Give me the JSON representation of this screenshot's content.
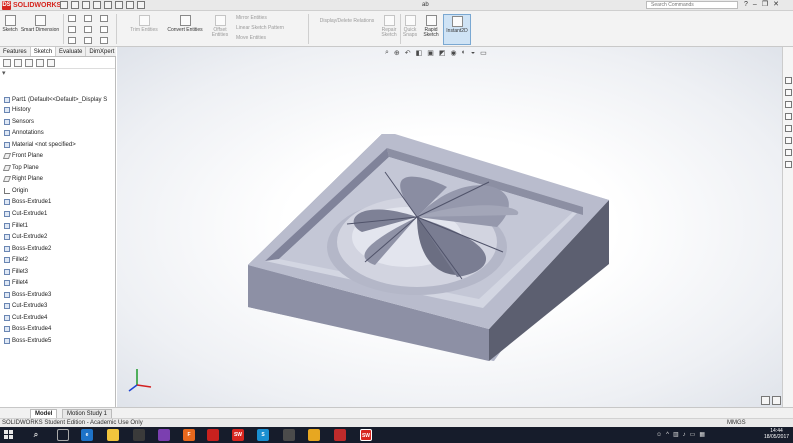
{
  "app": {
    "logo_text": "SOLIDWORKS",
    "logo_mark": "DS",
    "doc_title": "ab",
    "search_placeholder": "Search Commands"
  },
  "ribbon": {
    "sketch": "Sketch",
    "smart_dimension": "Smart Dimension",
    "trim": "Trim Entities",
    "convert": "Convert Entities",
    "offset": "Offset Entities",
    "mirror": "Mirror Entities",
    "linear_pattern": "Linear Sketch Pattern",
    "move": "Move Entities",
    "display_relations": "Display/Delete Relations",
    "repair": "Repair Sketch",
    "quick_snaps": "Quick Snaps",
    "rapid_sketch": "Rapid Sketch",
    "instant2d": "Instant2D"
  },
  "command_tabs": [
    "Features",
    "Sketch",
    "Evaluate",
    "DimXpert"
  ],
  "tree": {
    "filter_icon": "funnel-icon",
    "root": "Part1 (Default<<Default>_Display S",
    "items": [
      "History",
      "Sensors",
      "Annotations",
      "Material <not specified>",
      "Front Plane",
      "Top Plane",
      "Right Plane",
      "Origin",
      "Boss-Extrude1",
      "Cut-Extrude1",
      "Fillet1",
      "Cut-Extrude2",
      "Boss-Extrude2",
      "Fillet2",
      "Fillet3",
      "Fillet4",
      "Boss-Extrude3",
      "Cut-Extrude3",
      "Cut-Extrude4",
      "Boss-Extrude4",
      "Boss-Extrude5"
    ]
  },
  "bottom_tabs": {
    "model": "Model",
    "motion": "Motion Study 1"
  },
  "status": {
    "text": "SOLIDWORKS Student Edition - Academic Use Only",
    "units": "MMGS"
  },
  "clock": {
    "time": "14:44",
    "date": "18/05/2017"
  }
}
